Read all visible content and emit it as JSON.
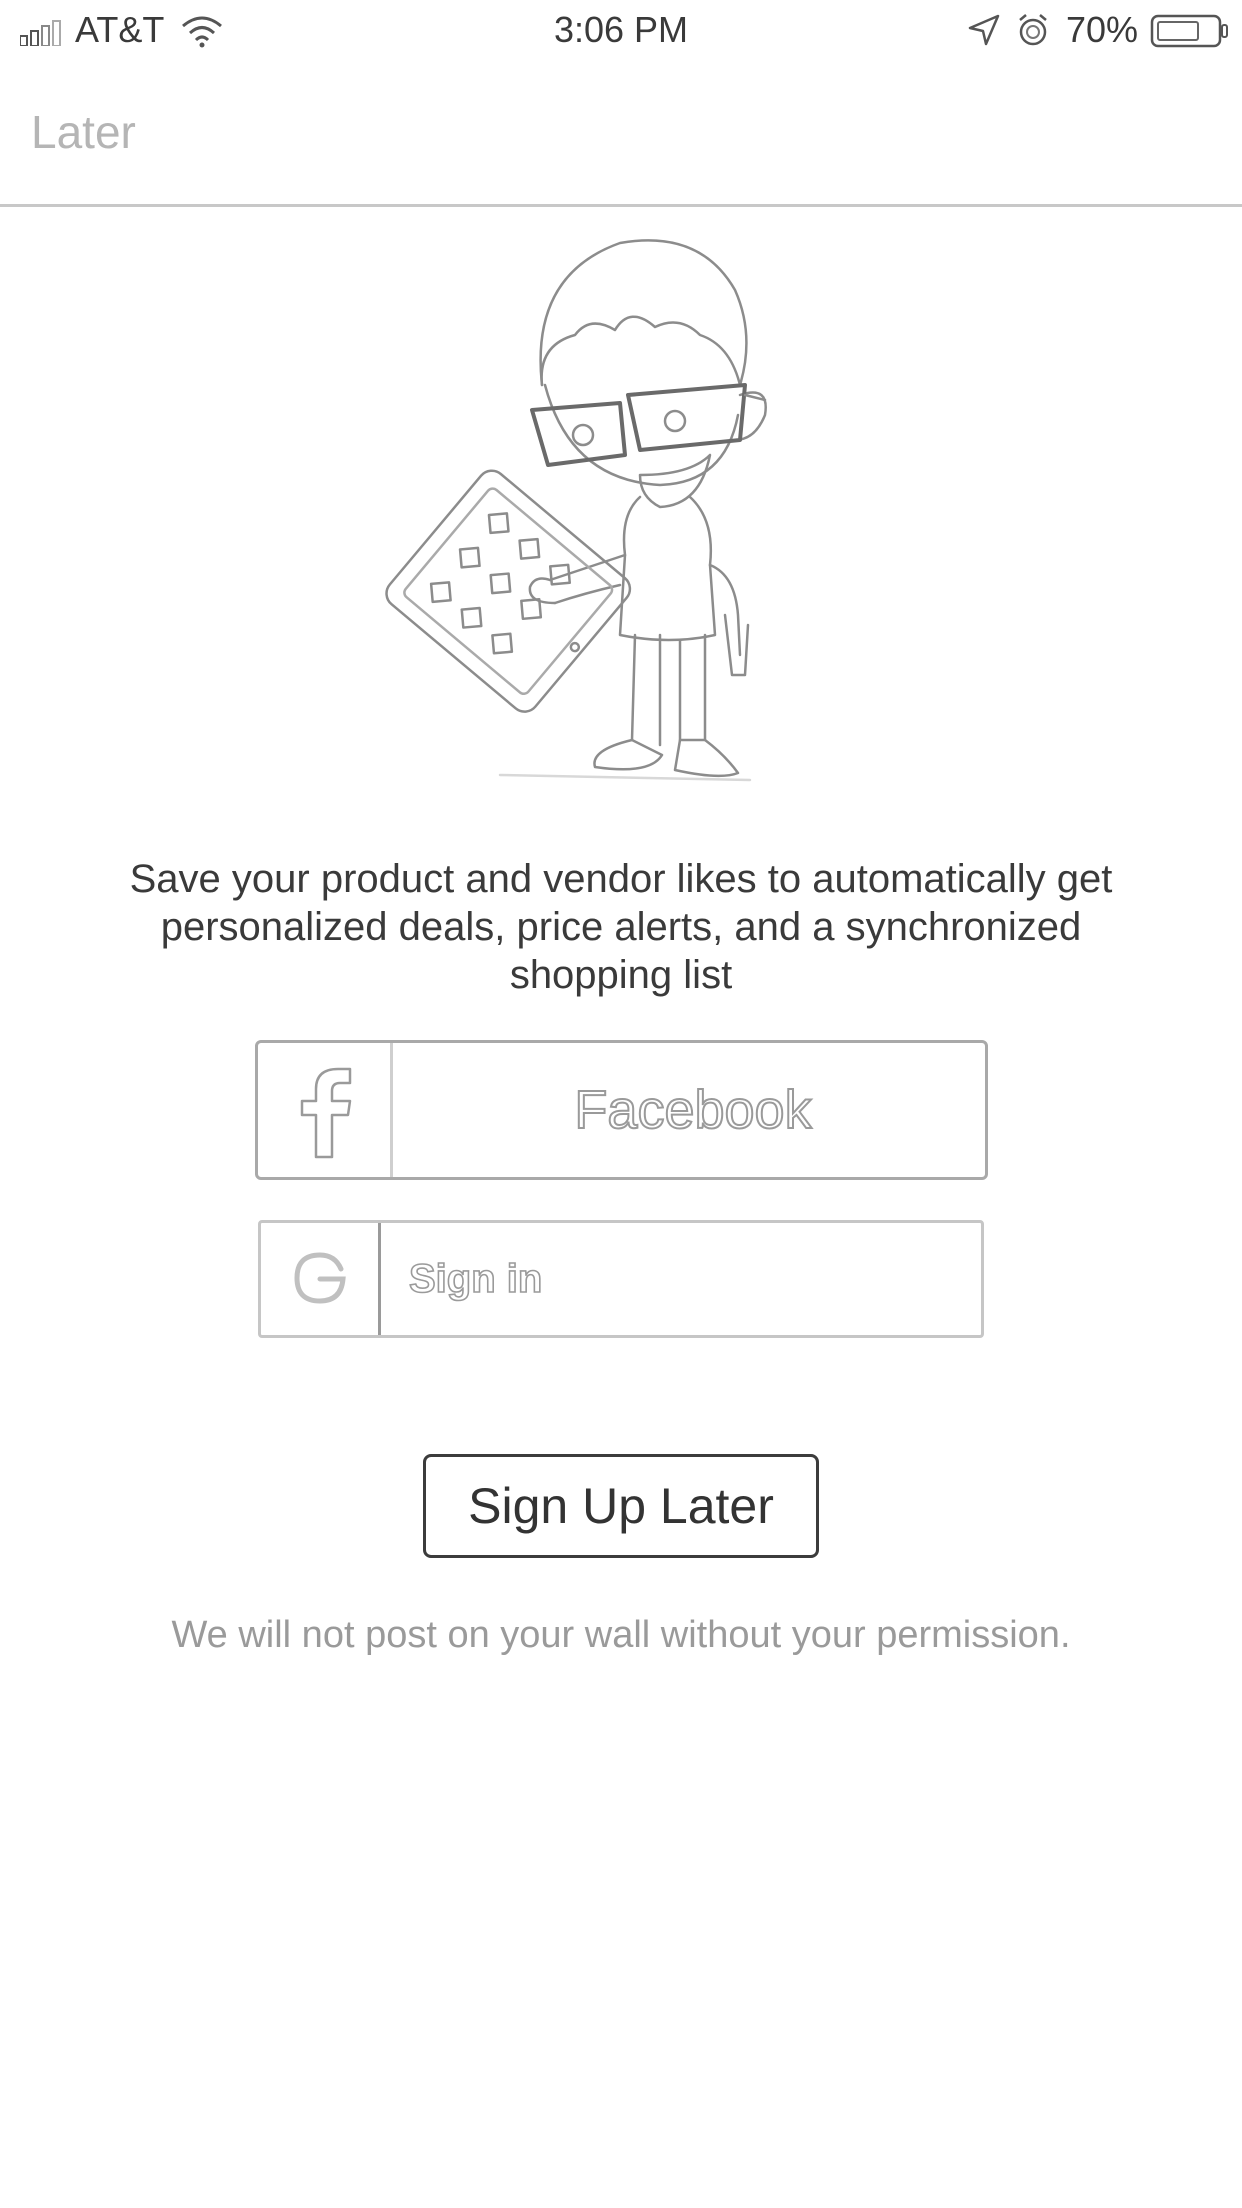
{
  "status_bar": {
    "carrier": "AT&T",
    "time": "3:06 PM",
    "battery_percent": "70%",
    "icons": [
      "signal-icon",
      "wifi-icon",
      "location-icon",
      "alarm-icon",
      "battery-icon"
    ]
  },
  "nav": {
    "later_label": "Later"
  },
  "hero": {
    "illustration": "boy-with-glasses-holding-tablet"
  },
  "main": {
    "description": "Save your product and vendor likes to automatically get personalized deals, price alerts, and a synchronized shopping list",
    "facebook_label": "Facebook",
    "google_label": "Sign in",
    "signup_later_label": "Sign Up Later",
    "permission_note": "We will not post on your wall without your permission."
  }
}
